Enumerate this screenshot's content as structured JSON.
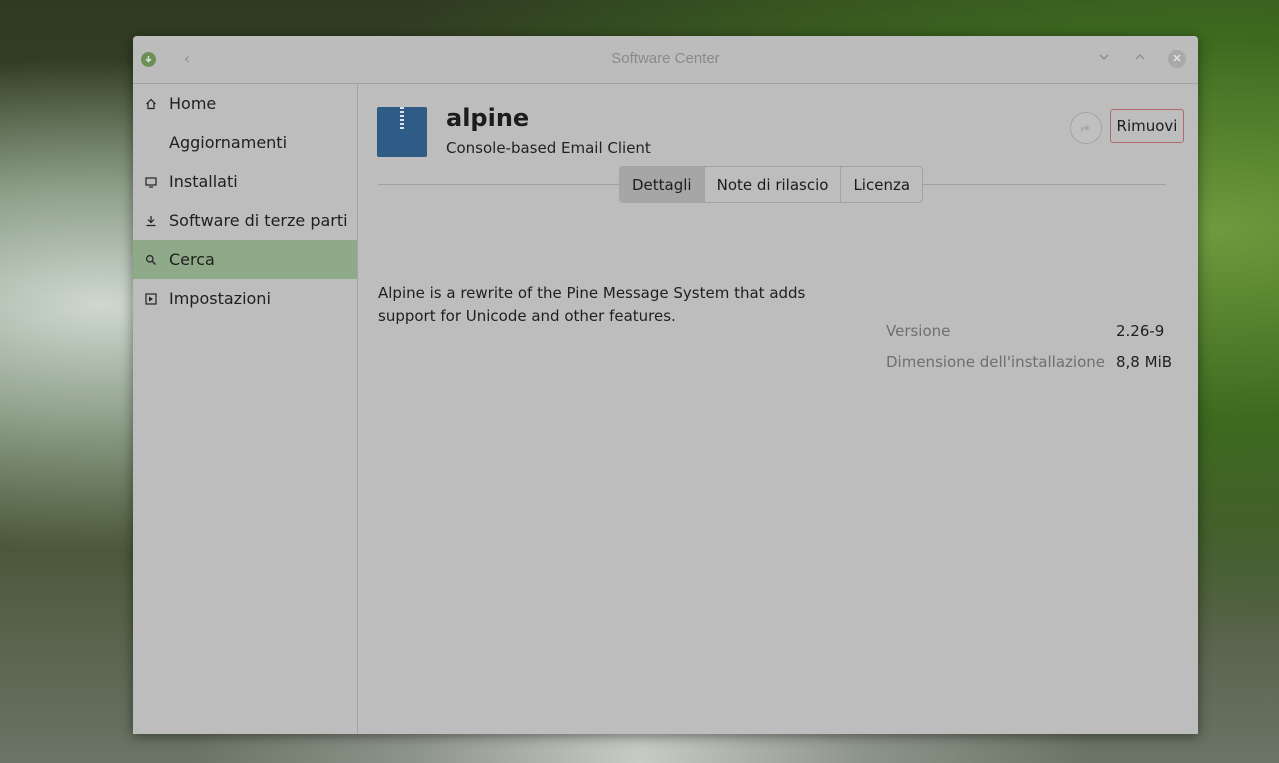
{
  "window": {
    "title": "Software Center"
  },
  "sidebar": {
    "items": [
      {
        "label": "Home",
        "icon": "home-icon",
        "active": false
      },
      {
        "label": "Aggiornamenti",
        "icon": "",
        "active": false
      },
      {
        "label": "Installati",
        "icon": "monitor-icon",
        "active": false
      },
      {
        "label": "Software di terze parti",
        "icon": "download-icon",
        "active": false
      },
      {
        "label": "Cerca",
        "icon": "search-icon",
        "active": true
      },
      {
        "label": "Impostazioni",
        "icon": "settings-icon",
        "active": false
      }
    ]
  },
  "package": {
    "name": "alpine",
    "summary": "Console-based Email Client",
    "remove_label": "Rimuovi",
    "description": "Alpine is a rewrite of the Pine Message System that adds support for Unicode and other features."
  },
  "tabs": [
    {
      "label": "Dettagli",
      "active": true
    },
    {
      "label": "Note di rilascio",
      "active": false
    },
    {
      "label": "Licenza",
      "active": false
    }
  ],
  "details": {
    "version_label": "Versione",
    "version_value": "2.26-9",
    "size_label": "Dimensione dell'installazione",
    "size_value": "8,8 MiB"
  },
  "colors": {
    "active_item": "#8faa89",
    "package_icon": "#2f5b87",
    "remove_border": "#b06a6a"
  }
}
